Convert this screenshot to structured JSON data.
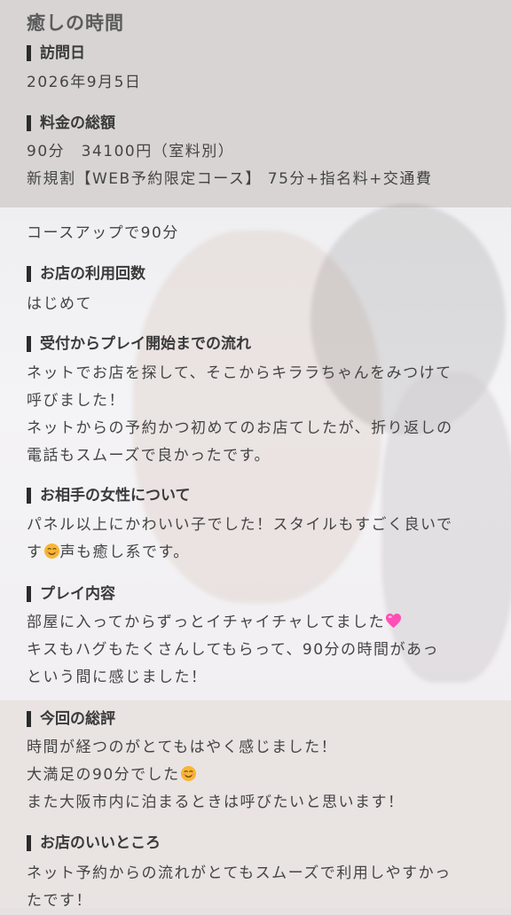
{
  "page": {
    "title": "癒しの時間"
  },
  "sections": {
    "visit_date": {
      "heading": "訪問日",
      "lines": [
        "2026年9月5日"
      ]
    },
    "total_fee": {
      "heading": "料金の総額",
      "lines": [
        "90分　34100円（室料別）",
        "新規割【WEB予約限定コース】 75分+指名料+交通費",
        "コースアップで90分"
      ]
    },
    "visit_count": {
      "heading": "お店の利用回数",
      "lines": [
        "はじめて"
      ]
    },
    "flow": {
      "heading": "受付からプレイ開始までの流れ",
      "lines": [
        "ネットでお店を探して、そこからキララちゃんをみつけて呼びました！",
        "ネットからの予約かつ初めてのお店てしたが、折り返しの電話もスムーズで良かったです。"
      ]
    },
    "partner": {
      "heading": "お相手の女性について",
      "line_a": "パネル以上にかわいい子でした！スタイルもすごく良いです",
      "line_b": "声も癒し系です。"
    },
    "play": {
      "heading": "プレイ内容",
      "line_a": "部屋に入ってからずっとイチャイチャしてました",
      "lines": [
        "キスもハグもたくさんしてもらって、90分の時間があっという間に感じました！"
      ]
    },
    "review": {
      "heading": "今回の総評",
      "line_1": "時間が経つのがとてもはやく感じました！",
      "line_2": "大満足の90分でした",
      "line_3": "また大阪市内に泊まるときは呼びたいと思います！"
    },
    "good_points": {
      "heading": "お店のいいところ",
      "lines": [
        "ネット予約からの流れがとてもスムーズで利用しやすかったです！"
      ]
    }
  },
  "icons": {
    "smile": "smiling-face-emoji",
    "heart": "pink-heart-emoji"
  },
  "colors": {
    "heart": "#ff4fb5",
    "smile": "#f7b733"
  }
}
